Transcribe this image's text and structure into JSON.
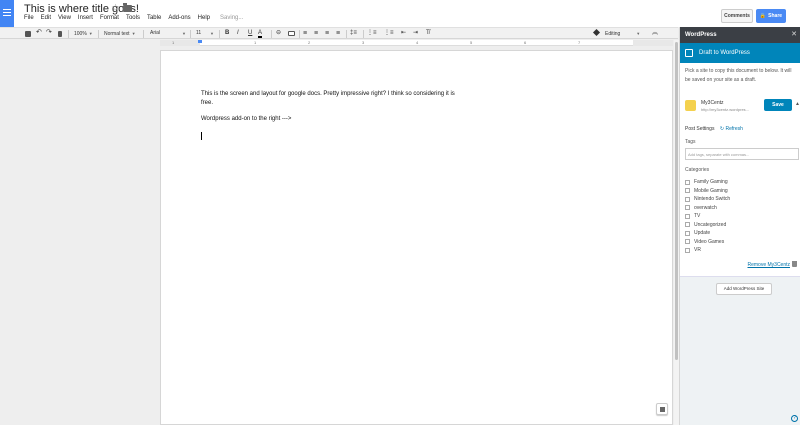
{
  "header": {
    "doc_title": "This is where title goes!",
    "menu": [
      "File",
      "Edit",
      "View",
      "Insert",
      "Format",
      "Tools",
      "Table",
      "Add-ons",
      "Help"
    ],
    "saving_status": "Saving...",
    "comments_label": "Comments",
    "share_label": "Share"
  },
  "toolbar": {
    "zoom": "100%",
    "style": "Normal text",
    "font": "Arial",
    "font_size": "11",
    "bold": "B",
    "italic": "I",
    "underline": "U",
    "text_color": "A",
    "mode": "Editing"
  },
  "ruler": {
    "ticks": [
      "1",
      "1",
      "2",
      "3",
      "4",
      "5",
      "6",
      "7"
    ]
  },
  "document": {
    "paragraph_1": "This is the screen and layout for google docs. Pretty impressive right? I think so considering it is free.",
    "paragraph_2": "Wordpress add-on to the right --->"
  },
  "panel": {
    "title": "WordPress",
    "draft_label": "Draft to WordPress",
    "intro": "Pick a site to copy this document to below. It will be saved on your site as a draft.",
    "site_name": "My3Centz",
    "site_url": "http://my3centz.wordpres...",
    "save_label": "Save",
    "post_settings_label": "Post Settings",
    "refresh_label": "Refresh",
    "tags_label": "Tags",
    "tags_placeholder": "Add tags, separate with commas...",
    "categories_label": "Categories",
    "categories": [
      "Family Gaming",
      "Mobile Gaming",
      "Nintendo Switch",
      "overwatch",
      "TV",
      "Uncategorized",
      "Update",
      "Video Games",
      "VR"
    ],
    "remove_site_label": "Remove My3Centz",
    "add_site_label": "Add WordPress Site"
  },
  "colors": {
    "docs_blue": "#4285f4",
    "wp_blue": "#0085ba",
    "panel_header": "#3b3f45"
  },
  "icons": [
    "docs-logo-icon",
    "star-icon",
    "folder-icon",
    "print-icon",
    "undo-icon",
    "redo-icon",
    "paint-format-icon",
    "link-icon",
    "comment-icon",
    "align-left-icon",
    "align-center-icon",
    "align-right-icon",
    "align-justify-icon",
    "line-spacing-icon",
    "numbered-list-icon",
    "bulleted-list-icon",
    "decrease-indent-icon",
    "increase-indent-icon",
    "clear-formatting-icon",
    "pencil-icon",
    "chevron-up-icon",
    "close-icon",
    "edit-icon",
    "refresh-icon",
    "trash-icon",
    "help-icon",
    "explore-icon"
  ]
}
